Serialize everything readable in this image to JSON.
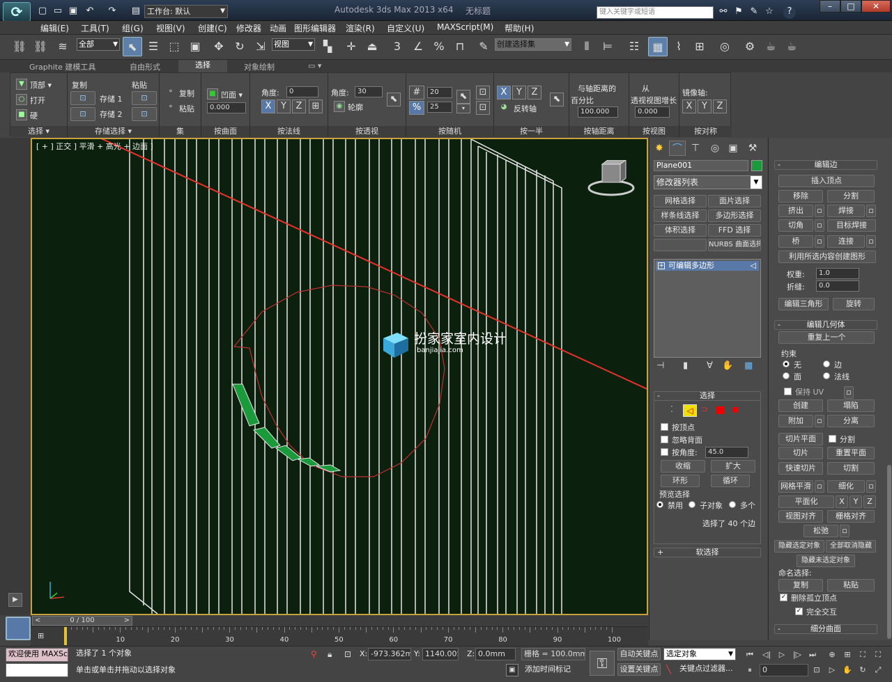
{
  "titlebar": {
    "workspace": "工作台: 默认",
    "app_title": "Autodesk 3ds Max  2013 x64",
    "doc_title": "无标题",
    "search_placeholder": "键入关键字或短语",
    "help": "?"
  },
  "menu": [
    "编辑(E)",
    "工具(T)",
    "组(G)",
    "视图(V)",
    "创建(C)",
    "修改器",
    "动画",
    "图形编辑器",
    "渲染(R)",
    "自定义(U)",
    "MAXScript(M)",
    "帮助(H)"
  ],
  "maintoolbar": {
    "filter": "全部",
    "refcoord": "视图",
    "selset": "创建选择集"
  },
  "ribbon_tabs": [
    "Graphite 建模工具",
    "自由形式",
    "选择",
    "对象绘制"
  ],
  "ribbon": {
    "sel_top": "顶部",
    "sel_open": "打开",
    "sel_hard": "硬",
    "copy": "复制",
    "paste": "粘贴",
    "store1": "存储 1",
    "store2": "存储 2",
    "set_copy": "复制",
    "set_paste": "粘贴",
    "concave": "凹面",
    "concave_val": "0.000",
    "angle_label": "角度:",
    "angle1_val": "0",
    "angle2_label": "角度:",
    "angle2_val": "30",
    "outline": "轮廓",
    "rand1": "20",
    "rand2": "25",
    "invert_axis": "反转轴",
    "dist_line1": "与轴距离的",
    "dist_line2": "百分比",
    "dist_val": "100.000",
    "persp_line1": "从",
    "persp_line2": "透视视图增长",
    "persp_val": "0.000",
    "mirror_axis": "镜像轴:",
    "groups": [
      "选择 ▾",
      "存储选择 ▾",
      "集",
      "按曲面",
      "按法线",
      "按透视",
      "按随机",
      "按一半",
      "按轴距离",
      "按视图",
      "按对称"
    ]
  },
  "viewport": {
    "label": "[ + ] 正交 ] 平滑 + 高光 + 边面 ]",
    "watermark": "扮家家室内设计",
    "watermark_sub": "banjiajia.com"
  },
  "cmdpanel": {
    "object_name": "Plane001",
    "object_color": "#1a9a3a",
    "modifier_list": "修改器列表",
    "mod_buttons": [
      "网格选择",
      "面片选择",
      "样条线选择",
      "多边形选择",
      "体积选择",
      "FFD 选择",
      "",
      "NURBS 曲面选择"
    ],
    "stack_item": "可编辑多边形",
    "selection_title": "选择",
    "by_vertex": "按顶点",
    "ignore_back": "忽略背面",
    "by_angle": "按角度:",
    "angle_val": "45.0",
    "shrink": "收缩",
    "grow": "扩大",
    "ring": "环形",
    "loop": "循环",
    "preview_title": "预览选择",
    "preview_opts": [
      "禁用",
      "子对象",
      "多个"
    ],
    "status": "选择了 40 个边",
    "soft_sel": "软选择"
  },
  "rightpanel": {
    "edit_edges": "编辑边",
    "insert_vertex": "插入顶点",
    "remove": "移除",
    "split": "分割",
    "extrude": "挤出",
    "weld": "焊接",
    "chamfer": "切角",
    "target_weld": "目标焊接",
    "bridge": "桥",
    "connect": "连接",
    "create_shape": "利用所选内容创建图形",
    "weight_label": "权重:",
    "weight_val": "1.0",
    "crease_label": "折缝:",
    "crease_val": "0.0",
    "edit_tri": "编辑三角形",
    "turn": "旋转",
    "edit_geom": "编辑几何体",
    "repeat_last": "重复上一个",
    "constraint": "约束",
    "c_none": "无",
    "c_edge": "边",
    "c_face": "面",
    "c_normal": "法线",
    "preserve_uv": "保持 UV",
    "create": "创建",
    "collapse": "塌陷",
    "attach": "附加",
    "detach": "分离",
    "slice_plane": "切片平面",
    "split2": "分割",
    "slice": "切片",
    "reset_plane": "重置平面",
    "quickslice": "快速切片",
    "cut": "切割",
    "meshsmooth": "网格平滑",
    "tessellate": "细化",
    "planarize": "平面化",
    "view_align": "视图对齐",
    "grid_align": "栅格对齐",
    "relax": "松弛",
    "hide_sel": "隐藏选定对象",
    "unhide_all": "全部取消隐藏",
    "hide_unsel": "隐藏未选定对象",
    "named_sel": "命名选择:",
    "copy": "复制",
    "paste": "粘贴",
    "delete_iso": "删除孤立顶点",
    "full_interact": "完全交互",
    "subdiv": "细分曲面"
  },
  "timeline": {
    "slider": "0 / 100",
    "ticks": [
      "10",
      "20",
      "30",
      "40",
      "50",
      "60",
      "70",
      "80",
      "90",
      "100"
    ]
  },
  "status": {
    "welcome": "欢迎使用 MAXSc",
    "selected": "选择了 1 个对象",
    "prompt": "单击或单击并拖动以选择对象",
    "x_label": "X:",
    "x_val": "-973.362m",
    "y_label": "Y:",
    "y_val": "1140.005m",
    "z_label": "Z:",
    "z_val": "0.0mm",
    "grid": "栅格 = 100.0mm",
    "auto_key": "自动关键点",
    "set_key": "设置关键点",
    "selected_obj": "选定对象",
    "key_filters": "关键点过滤器...",
    "add_time_tag": "添加时间标记",
    "frame": "0"
  }
}
